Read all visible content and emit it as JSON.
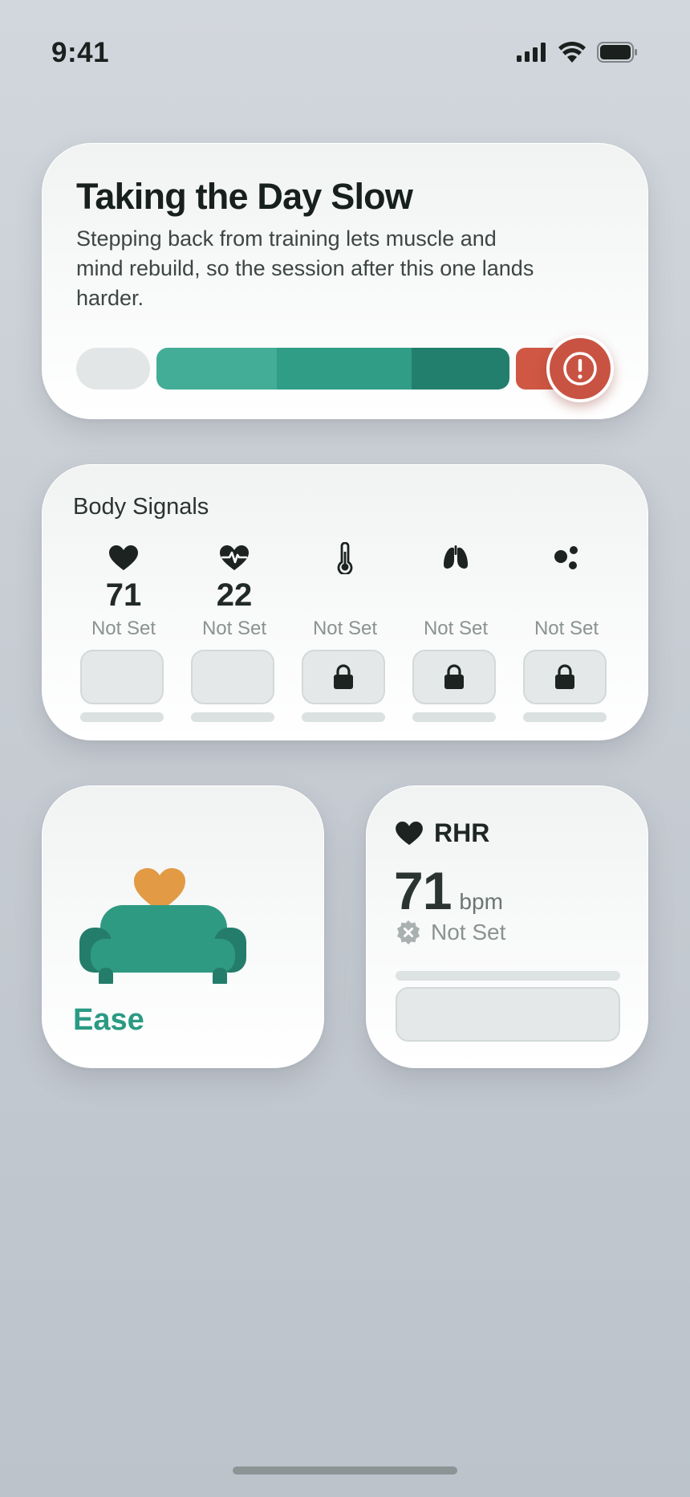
{
  "status_bar": {
    "time": "9:41",
    "icons": [
      "cellular-signal-icon",
      "wifi-icon",
      "battery-icon"
    ]
  },
  "recovery_card": {
    "title": "Taking the Day Slow",
    "body": "Stepping back from training lets muscle and mind rebuild, so the session after this one lands harder.",
    "alert_icon": "alert-circle-icon",
    "colors": {
      "gray": "#e2e6e6",
      "teal_light": "#43ad97",
      "teal_mid": "#309d87",
      "teal_dark": "#237f6d",
      "red": "#cf5744"
    }
  },
  "body_signals": {
    "title": "Body Signals",
    "items": [
      {
        "icon": "heart-icon",
        "value": "71",
        "status": "Not Set",
        "locked": false
      },
      {
        "icon": "heart-pulse-icon",
        "value": "22",
        "status": "Not Set",
        "locked": false
      },
      {
        "icon": "thermometer-icon",
        "value": "",
        "status": "Not Set",
        "locked": true
      },
      {
        "icon": "lungs-icon",
        "value": "",
        "status": "Not Set",
        "locked": true
      },
      {
        "icon": "dots-icon",
        "value": "",
        "status": "Not Set",
        "locked": true
      }
    ]
  },
  "ease_card": {
    "label": "Ease",
    "illustration": "sofa-with-heart-icon",
    "accent": "#2a9a83"
  },
  "rhr_card": {
    "title": "RHR",
    "icon": "heart-icon",
    "value": "71",
    "unit": "bpm",
    "status": "Not Set",
    "status_icon": "not-set-badge-icon"
  }
}
